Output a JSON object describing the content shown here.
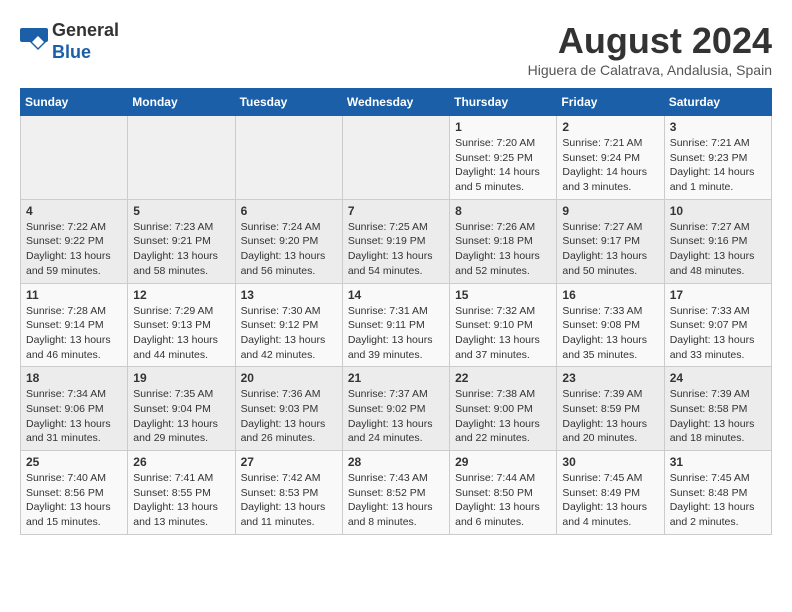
{
  "header": {
    "logo_line1": "General",
    "logo_line2": "Blue",
    "month": "August 2024",
    "location": "Higuera de Calatrava, Andalusia, Spain"
  },
  "weekdays": [
    "Sunday",
    "Monday",
    "Tuesday",
    "Wednesday",
    "Thursday",
    "Friday",
    "Saturday"
  ],
  "weeks": [
    [
      {
        "day": "",
        "info": ""
      },
      {
        "day": "",
        "info": ""
      },
      {
        "day": "",
        "info": ""
      },
      {
        "day": "",
        "info": ""
      },
      {
        "day": "1",
        "info": "Sunrise: 7:20 AM\nSunset: 9:25 PM\nDaylight: 14 hours\nand 5 minutes."
      },
      {
        "day": "2",
        "info": "Sunrise: 7:21 AM\nSunset: 9:24 PM\nDaylight: 14 hours\nand 3 minutes."
      },
      {
        "day": "3",
        "info": "Sunrise: 7:21 AM\nSunset: 9:23 PM\nDaylight: 14 hours\nand 1 minute."
      }
    ],
    [
      {
        "day": "4",
        "info": "Sunrise: 7:22 AM\nSunset: 9:22 PM\nDaylight: 13 hours\nand 59 minutes."
      },
      {
        "day": "5",
        "info": "Sunrise: 7:23 AM\nSunset: 9:21 PM\nDaylight: 13 hours\nand 58 minutes."
      },
      {
        "day": "6",
        "info": "Sunrise: 7:24 AM\nSunset: 9:20 PM\nDaylight: 13 hours\nand 56 minutes."
      },
      {
        "day": "7",
        "info": "Sunrise: 7:25 AM\nSunset: 9:19 PM\nDaylight: 13 hours\nand 54 minutes."
      },
      {
        "day": "8",
        "info": "Sunrise: 7:26 AM\nSunset: 9:18 PM\nDaylight: 13 hours\nand 52 minutes."
      },
      {
        "day": "9",
        "info": "Sunrise: 7:27 AM\nSunset: 9:17 PM\nDaylight: 13 hours\nand 50 minutes."
      },
      {
        "day": "10",
        "info": "Sunrise: 7:27 AM\nSunset: 9:16 PM\nDaylight: 13 hours\nand 48 minutes."
      }
    ],
    [
      {
        "day": "11",
        "info": "Sunrise: 7:28 AM\nSunset: 9:14 PM\nDaylight: 13 hours\nand 46 minutes."
      },
      {
        "day": "12",
        "info": "Sunrise: 7:29 AM\nSunset: 9:13 PM\nDaylight: 13 hours\nand 44 minutes."
      },
      {
        "day": "13",
        "info": "Sunrise: 7:30 AM\nSunset: 9:12 PM\nDaylight: 13 hours\nand 42 minutes."
      },
      {
        "day": "14",
        "info": "Sunrise: 7:31 AM\nSunset: 9:11 PM\nDaylight: 13 hours\nand 39 minutes."
      },
      {
        "day": "15",
        "info": "Sunrise: 7:32 AM\nSunset: 9:10 PM\nDaylight: 13 hours\nand 37 minutes."
      },
      {
        "day": "16",
        "info": "Sunrise: 7:33 AM\nSunset: 9:08 PM\nDaylight: 13 hours\nand 35 minutes."
      },
      {
        "day": "17",
        "info": "Sunrise: 7:33 AM\nSunset: 9:07 PM\nDaylight: 13 hours\nand 33 minutes."
      }
    ],
    [
      {
        "day": "18",
        "info": "Sunrise: 7:34 AM\nSunset: 9:06 PM\nDaylight: 13 hours\nand 31 minutes."
      },
      {
        "day": "19",
        "info": "Sunrise: 7:35 AM\nSunset: 9:04 PM\nDaylight: 13 hours\nand 29 minutes."
      },
      {
        "day": "20",
        "info": "Sunrise: 7:36 AM\nSunset: 9:03 PM\nDaylight: 13 hours\nand 26 minutes."
      },
      {
        "day": "21",
        "info": "Sunrise: 7:37 AM\nSunset: 9:02 PM\nDaylight: 13 hours\nand 24 minutes."
      },
      {
        "day": "22",
        "info": "Sunrise: 7:38 AM\nSunset: 9:00 PM\nDaylight: 13 hours\nand 22 minutes."
      },
      {
        "day": "23",
        "info": "Sunrise: 7:39 AM\nSunset: 8:59 PM\nDaylight: 13 hours\nand 20 minutes."
      },
      {
        "day": "24",
        "info": "Sunrise: 7:39 AM\nSunset: 8:58 PM\nDaylight: 13 hours\nand 18 minutes."
      }
    ],
    [
      {
        "day": "25",
        "info": "Sunrise: 7:40 AM\nSunset: 8:56 PM\nDaylight: 13 hours\nand 15 minutes."
      },
      {
        "day": "26",
        "info": "Sunrise: 7:41 AM\nSunset: 8:55 PM\nDaylight: 13 hours\nand 13 minutes."
      },
      {
        "day": "27",
        "info": "Sunrise: 7:42 AM\nSunset: 8:53 PM\nDaylight: 13 hours\nand 11 minutes."
      },
      {
        "day": "28",
        "info": "Sunrise: 7:43 AM\nSunset: 8:52 PM\nDaylight: 13 hours\nand 8 minutes."
      },
      {
        "day": "29",
        "info": "Sunrise: 7:44 AM\nSunset: 8:50 PM\nDaylight: 13 hours\nand 6 minutes."
      },
      {
        "day": "30",
        "info": "Sunrise: 7:45 AM\nSunset: 8:49 PM\nDaylight: 13 hours\nand 4 minutes."
      },
      {
        "day": "31",
        "info": "Sunrise: 7:45 AM\nSunset: 8:48 PM\nDaylight: 13 hours\nand 2 minutes."
      }
    ]
  ]
}
